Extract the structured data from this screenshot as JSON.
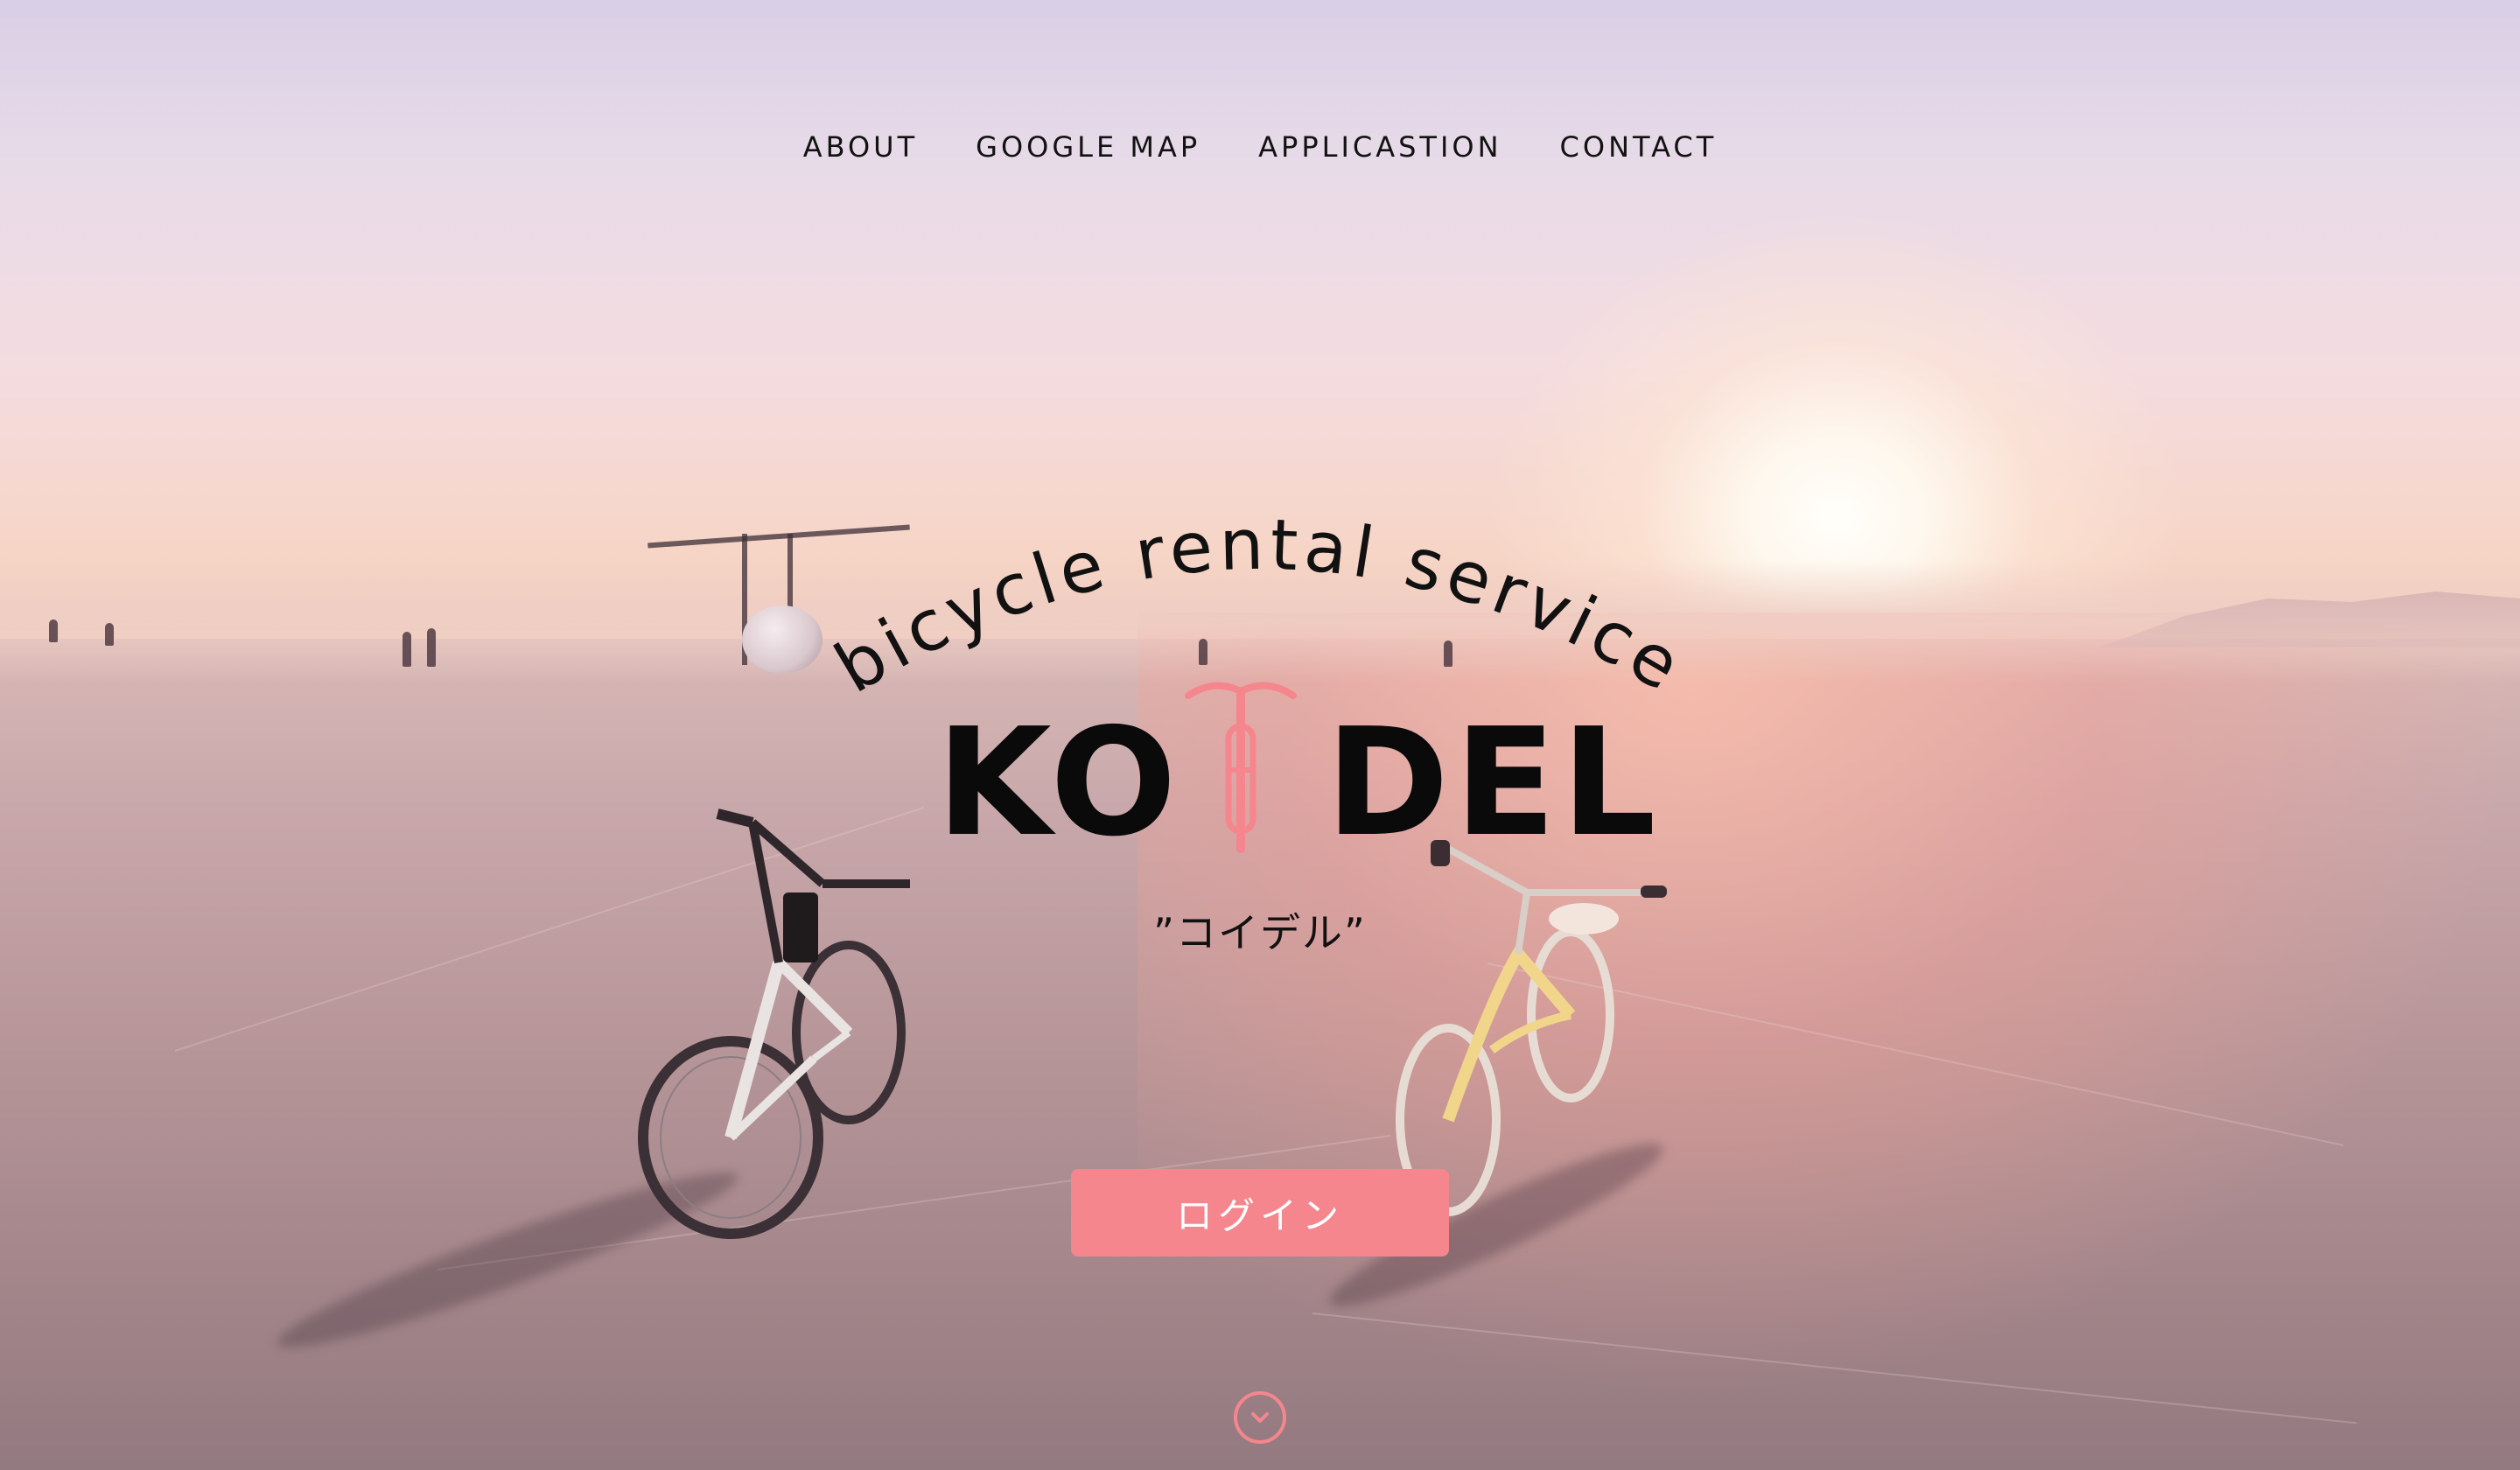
{
  "nav": {
    "items": [
      "ABOUT",
      "GOOGLE MAP",
      "APPLICASTION",
      "CONTACT"
    ]
  },
  "hero": {
    "tagline": "bicycle rental service",
    "brand_left": "KO",
    "brand_right": "DEL",
    "subtitle": "”コイデル”",
    "login_label": "ログイン"
  },
  "icons": {
    "brand_bike": "bicycle-icon",
    "scroll": "chevron-down-icon"
  },
  "colors": {
    "accent": "#f5868d",
    "text": "#121212"
  }
}
